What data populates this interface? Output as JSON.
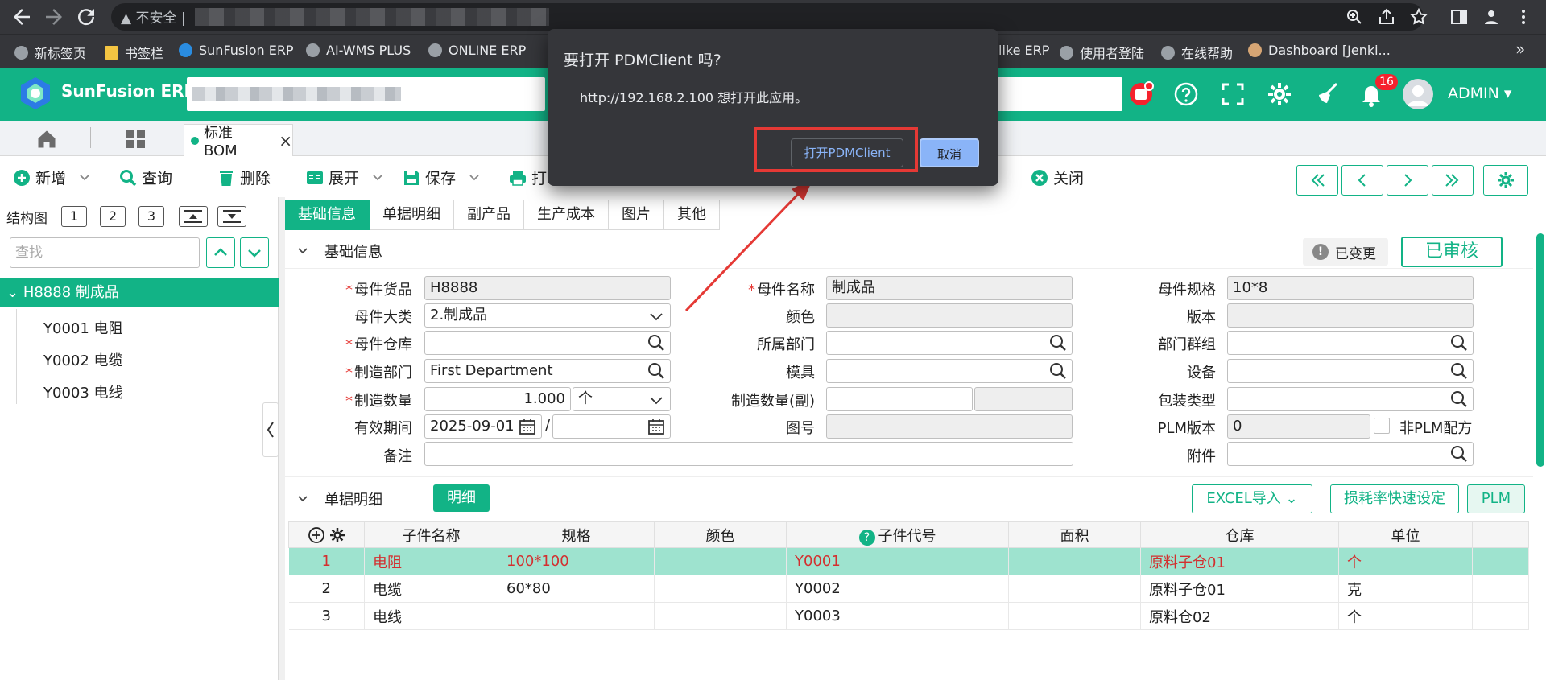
{
  "browser": {
    "url_prefix": "不安全 |",
    "bookmarks": [
      "新标签页",
      "书签栏",
      "SunFusion ERP",
      "AI-WMS PLUS",
      "ONLINE ERP",
      "like ERP",
      "使用者登陆",
      "在线帮助",
      "Dashboard [Jenki..."
    ],
    "more": "»"
  },
  "dialog": {
    "title": "要打开 PDMClient 吗?",
    "message": "http://192.168.2.100 想打开此应用。",
    "open_label": "打开PDMClient",
    "cancel_label": "取消"
  },
  "app": {
    "brand": "SunFusion ERP",
    "notifications": "16",
    "user": "ADMIN",
    "accent": "#12b386"
  },
  "tabs": {
    "active": "标准BOM",
    "close": "×"
  },
  "toolbar": {
    "add": "新增",
    "query": "查询",
    "delete": "删除",
    "expand": "展开",
    "save": "保存",
    "print": "打",
    "close": "关闭"
  },
  "left": {
    "title": "结构图",
    "levels": [
      "1",
      "2",
      "3"
    ],
    "search_placeholder": "查找",
    "root": "H8888 制成品",
    "children": [
      "Y0001 电阻",
      "Y0002 电缆",
      "Y0003 电线"
    ]
  },
  "subtabs": [
    "基础信息",
    "单据明细",
    "副产品",
    "生产成本",
    "图片",
    "其他"
  ],
  "basic": {
    "section": "基础信息",
    "changed": "已变更",
    "status": "已审核",
    "labels": {
      "parent_item": "母件货品",
      "parent_class": "母件大类",
      "parent_wh": "母件仓库",
      "mfg_dept": "制造部门",
      "mfg_qty": "制造数量",
      "valid": "有效期间",
      "remark": "备注",
      "parent_name": "母件名称",
      "color": "颜色",
      "dept": "所属部门",
      "mold": "模具",
      "mfg_qty2": "制造数量(副)",
      "drawing": "图号",
      "parent_spec": "母件规格",
      "version": "版本",
      "dept_group": "部门群组",
      "equipment": "设备",
      "pack_type": "包装类型",
      "plm_ver": "PLM版本",
      "attachment": "附件"
    },
    "values": {
      "parent_item": "H8888",
      "parent_class": "2.制成品",
      "mfg_dept": "First Department",
      "mfg_qty": "1.000",
      "unit": "个",
      "valid_from": "2025-09-01",
      "sep": "/",
      "parent_name": "制成品",
      "parent_spec": "10*8",
      "plm_ver": "0",
      "non_plm": "非PLM配方"
    }
  },
  "detail": {
    "section": "单据明细",
    "tab": "明细",
    "excel": "EXCEL导入",
    "loss": "损耗率快速设定",
    "plm": "PLM",
    "headers": [
      "子件名称",
      "规格",
      "颜色",
      "子件代号",
      "面积",
      "仓库",
      "单位"
    ],
    "rows": [
      {
        "no": "1",
        "name": "电阻",
        "spec": "100*100",
        "color": "",
        "code": "Y0001",
        "area": "",
        "wh": "原料子仓01",
        "unit": "个"
      },
      {
        "no": "2",
        "name": "电缆",
        "spec": "60*80",
        "color": "",
        "code": "Y0002",
        "area": "",
        "wh": "原料子仓01",
        "unit": "克"
      },
      {
        "no": "3",
        "name": "电线",
        "spec": "",
        "color": "",
        "code": "Y0003",
        "area": "",
        "wh": "原料仓02",
        "unit": "个"
      }
    ]
  }
}
